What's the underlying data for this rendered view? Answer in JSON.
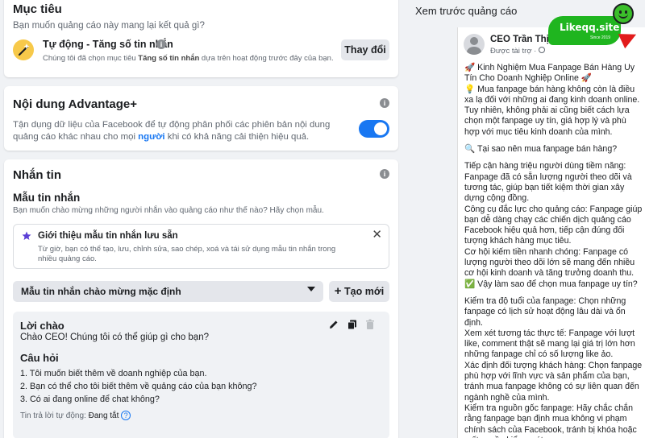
{
  "objective": {
    "title": "Mục tiêu",
    "question": "Bạn muốn quảng cáo này mang lại kết quả gì?",
    "option_title": "Tự động - Tăng số tin nhắn",
    "option_desc_prefix": "Chúng tôi đã chọn mục tiêu ",
    "option_desc_bold": "Tăng số tin nhắn",
    "option_desc_suffix": " dựa trên hoạt động trước đây của bạn.",
    "change_button": "Thay đổi"
  },
  "advantage": {
    "title": "Nội dung Advantage+",
    "desc_prefix": "Tận dụng dữ liệu của Facebook để tự động phân phối các phiên bản nội dung quảng cáo khác nhau cho mọi ",
    "desc_link": "người",
    "desc_suffix": " khi có khả năng cải thiện hiệu quả.",
    "toggle_on": true
  },
  "messaging": {
    "title": "Nhắn tin",
    "template_title": "Mẫu tin nhắn",
    "template_question": "Bạn muốn chào mừng những người nhắn vào quảng cáo như thế nào? Hãy chọn mẫu.",
    "intro_title": "Giới thiệu mẫu tin nhắn lưu sẵn",
    "intro_desc": "Từ giờ, bạn có thể tạo, lưu, chỉnh sửa, sao chép, xoá và tái sử dụng mẫu tin nhắn trong nhiều quảng cáo.",
    "dropdown_value": "Mẫu tin nhắn chào mừng mặc định",
    "create_button": "Tạo mới",
    "greeting_title": "Lời chào",
    "greeting_text": "Chào CEO! Chúng tôi có thể giúp gì cho bạn?",
    "questions_title": "Câu hỏi",
    "questions": [
      "1. Tôi muốn biết thêm về doanh nghiệp của bạn.",
      "2. Bạn có thể cho tôi biết thêm về quảng cáo của bạn không?",
      "3. Có ai đang online để chat không?"
    ],
    "auto_reply_label": "Tin trả lời tự động:",
    "auto_reply_value": "Đang tắt"
  },
  "preview": {
    "title": "Xem trước quảng cáo",
    "page_name": "CEO Trần Thị Du",
    "sponsored": "Được tài trợ ·",
    "watermark_text": "Likeqq.site",
    "watermark_sub": "Since 2019",
    "paragraphs": [
      "🚀 Kinh Nghiệm Mua Fanpage Bán Hàng Uy Tín Cho Doanh Nghiệp Online 🚀",
      "💡 Mua fanpage bán hàng không còn là điều xa lạ đối với những ai đang kinh doanh online. Tuy nhiên, không phải ai cũng biết cách lựa chọn một fanpage uy tín, giá hợp lý và phù hợp với mục tiêu kinh doanh của mình.",
      "",
      "🔍 Tại sao nên mua fanpage bán hàng?",
      "",
      "Tiếp cận hàng triệu người dùng tiềm năng: Fanpage đã có sẵn lượng người theo dõi và tương tác, giúp bạn tiết kiệm thời gian xây dựng cộng đồng.",
      "Công cụ đắc lực cho quảng cáo: Fanpage giúp bạn dễ dàng chạy các chiến dịch quảng cáo Facebook hiệu quả hơn, tiếp cận đúng đối tượng khách hàng mục tiêu.",
      "Cơ hội kiếm tiền nhanh chóng: Fanpage có lượng người theo dõi lớn sẽ mang đến nhiều cơ hội kinh doanh và tăng trưởng doanh thu.",
      "✅ Vậy làm sao để chọn mua fanpage uy tín?",
      "",
      "Kiểm tra độ tuổi của fanpage: Chọn những fanpage có lịch sử hoạt động lâu dài và ổn định.",
      "Xem xét tương tác thực tế: Fanpage với lượt like, comment thật sẽ mang lại giá trị lớn hơn những fanpage chỉ có số lượng like ảo.",
      "Xác định đối tượng khách hàng: Chọn fanpage phù hợp với lĩnh vực và sản phẩm của bạn, tránh mua fanpage không có sự liên quan đến ngành nghề của mình.",
      "Kiểm tra nguồn gốc fanpage: Hãy chắc chắn rằng fanpage bạn định mua không vi phạm chính sách của Facebook, tránh bị khóa hoặc mất quyền kiểm soát."
    ]
  },
  "colors": {
    "accent": "#1877f2",
    "toggle": "#1877f2",
    "watermark_green": "#1fb51f",
    "watermark_red": "#e21b1b"
  }
}
